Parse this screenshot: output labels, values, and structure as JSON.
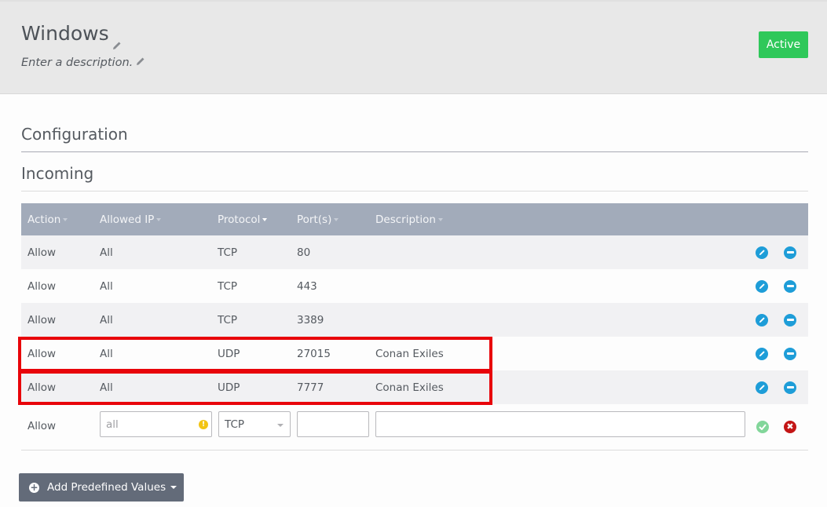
{
  "header": {
    "title": "Windows",
    "description": "Enter a description.",
    "status_button": "Active",
    "status_color": "#2fc85a"
  },
  "sections": {
    "configuration": "Configuration",
    "incoming": "Incoming"
  },
  "table": {
    "columns": [
      {
        "label": "Action",
        "sort_icon": "caret-down-icon"
      },
      {
        "label": "Allowed IP",
        "sort_icon": "caret-down-icon"
      },
      {
        "label": "Protocol",
        "sort_icon": "caret-down-icon",
        "active_sort": true
      },
      {
        "label": "Port(s)",
        "sort_icon": "caret-down-icon"
      },
      {
        "label": "Description",
        "sort_icon": "caret-down-icon"
      }
    ],
    "rows": [
      {
        "action": "Allow",
        "ip": "All",
        "protocol": "TCP",
        "ports": "80",
        "description": "",
        "highlighted": false
      },
      {
        "action": "Allow",
        "ip": "All",
        "protocol": "TCP",
        "ports": "443",
        "description": "",
        "highlighted": false
      },
      {
        "action": "Allow",
        "ip": "All",
        "protocol": "TCP",
        "ports": "3389",
        "description": "",
        "highlighted": false
      },
      {
        "action": "Allow",
        "ip": "All",
        "protocol": "UDP",
        "ports": "27015",
        "description": "Conan Exiles",
        "highlighted": true
      },
      {
        "action": "Allow",
        "ip": "All",
        "protocol": "UDP",
        "ports": "7777",
        "description": "Conan Exiles",
        "highlighted": true
      }
    ],
    "row_actions": {
      "edit_icon": "pencil-circle-icon",
      "remove_icon": "minus-circle-icon"
    },
    "new_rule": {
      "action": "Allow",
      "ip_placeholder": "all",
      "ip_value": "",
      "ip_warning_icon": "exclamation-circle-icon",
      "protocol_selected": "TCP",
      "ports_value": "",
      "description_value": "",
      "confirm_icon": "check-circle-icon",
      "cancel_icon": "x-circle-icon",
      "cancel_glyph": "✖"
    }
  },
  "footer": {
    "add_predefined_label": "Add Predefined Values"
  },
  "highlight_color": "#e8040a"
}
